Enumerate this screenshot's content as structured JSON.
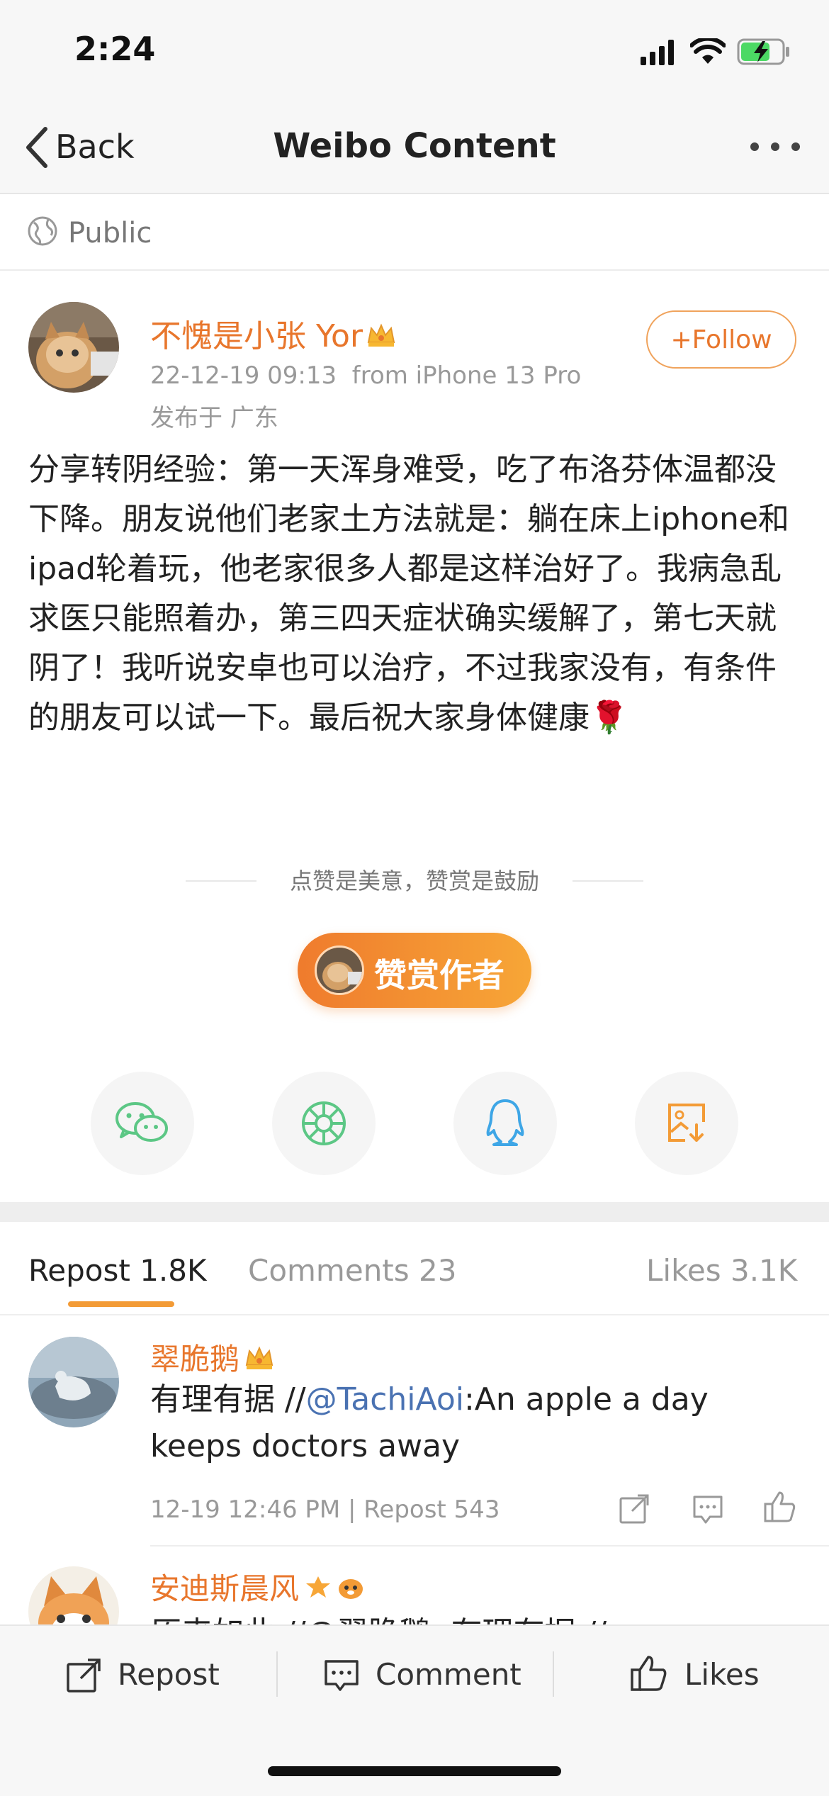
{
  "status_bar": {
    "time": "2:24"
  },
  "nav": {
    "back_label": "Back",
    "title": "Weibo Content",
    "more_icon": "more-dots-icon"
  },
  "visibility": {
    "label": "Public",
    "icon": "globe-icon"
  },
  "post": {
    "author_name": "不愧是小张 Yor",
    "time": "22-12-19 09:13",
    "source": "from iPhone 13 Pro",
    "location": "发布于 广东",
    "follow_label": "+Follow",
    "body": "分享转阴经验：第一天浑身难受，吃了布洛芬体温都没下降。朋友说他们老家土方法就是：躺在床上iphone和ipad轮着玩，他老家很多人都是这样治好了。我病急乱求医只能照着办，第三四天症状确实缓解了，第七天就阴了！我听说安卓也可以治疗，不过我家没有，有条件的朋友可以试一下。最后祝大家身体健康🌹"
  },
  "reward": {
    "hint": "点赞是美意，赞赏是鼓励",
    "button_label": "赞赏作者"
  },
  "share": {
    "icons": [
      "wechat-icon",
      "moments-icon",
      "qq-icon",
      "save-image-icon"
    ]
  },
  "tabs": {
    "repost": "Repost 1.8K",
    "comments": "Comments 23",
    "likes": "Likes 3.1K"
  },
  "reposts": [
    {
      "name": "翠脆鹅",
      "text_prefix": "有理有据 //",
      "mention": "@TachiAoi",
      "text_suffix": ":An apple a day keeps doctors away",
      "meta": "12-19 12:46 PM | Repost 543"
    },
    {
      "name": "安迪斯晨风",
      "text": "原来如此 //@翠脆鹅: 有理有据 //"
    }
  ],
  "bottom_bar": {
    "repost": "Repost",
    "comment": "Comment",
    "likes": "Likes"
  },
  "colors": {
    "accent": "#e8762c",
    "link": "#4a72b2",
    "reward_gradient_start": "#ef7b2d",
    "reward_gradient_end": "#f7a637"
  }
}
